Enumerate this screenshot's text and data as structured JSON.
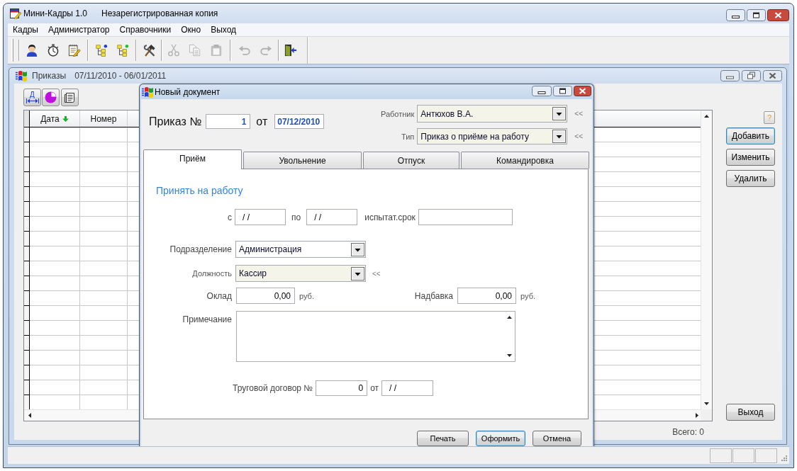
{
  "window": {
    "title": "Мини-Кадры 1.0",
    "subtitle": "Незарегистрированная копия"
  },
  "menu": [
    "Кадры",
    "Администратор",
    "Справочники",
    "Окно",
    "Выход"
  ],
  "toolbar": [
    [
      {
        "disabled": false
      },
      {
        "disabled": false
      },
      {
        "disabled": false
      }
    ],
    [
      {
        "disabled": false
      },
      {
        "disabled": false
      }
    ],
    [
      {
        "disabled": false
      }
    ],
    [
      {
        "disabled": true
      },
      {
        "disabled": true
      },
      {
        "disabled": true
      }
    ],
    [
      {
        "disabled": true
      },
      {
        "disabled": true
      }
    ],
    [
      {
        "disabled": false
      }
    ]
  ],
  "orders_window": {
    "title": "Приказы",
    "period": "07/11/2010 - 06/01/2011",
    "column_width_button": {
      "letter": "Д"
    },
    "table": {
      "columns": [
        {
          "label": "Дата",
          "sorted": true
        },
        {
          "label": "Номер",
          "sorted": false
        }
      ]
    },
    "total": "Всего: 0",
    "help_button": "?",
    "actions": [
      {
        "label": "Добавить",
        "focused": true
      },
      {
        "label": "Изменить",
        "focused": false
      },
      {
        "label": "Удалить",
        "focused": false
      }
    ],
    "exit_button": "Выход"
  },
  "dialog": {
    "title": "Новый документ",
    "order_label": "Приказ №",
    "order_number": "1",
    "date_label": "от",
    "date": "07/12/2010",
    "employee": {
      "label": "Работник",
      "value": "Антюхов В.А.",
      "link": "<<"
    },
    "order_type": {
      "label": "Тип",
      "value": "Приказ о приёме на работу",
      "link": "<<"
    },
    "tabs": [
      {
        "label": "Приём",
        "selected": true
      },
      {
        "label": "Увольнение",
        "selected": false
      },
      {
        "label": "Отпуск",
        "selected": false
      },
      {
        "label": "Командировка",
        "selected": false
      }
    ],
    "hire": {
      "title": "Принять на работу",
      "from_label": "с",
      "from": "/ /",
      "to_label": "по",
      "to": "/ /",
      "probation_label": "испытат.срок",
      "department": {
        "label": "Подразделение",
        "value": "Администрация"
      },
      "position": {
        "label": "Должность",
        "value": "Кассир",
        "link": "<<"
      },
      "salary": {
        "label": "Оклад",
        "value": "0,00",
        "unit": "руб."
      },
      "bonus": {
        "label": "Надбавка",
        "value": "0,00",
        "unit": "руб."
      },
      "note": {
        "label": "Примечание"
      },
      "contract": {
        "label": "Труговой договор №",
        "number": "0",
        "date_label": "от",
        "date": "/ /"
      }
    },
    "buttons": [
      {
        "label": "Печать",
        "focused": false
      },
      {
        "label": "Оформить",
        "focused": true
      },
      {
        "label": "Отмена",
        "focused": false
      }
    ]
  }
}
